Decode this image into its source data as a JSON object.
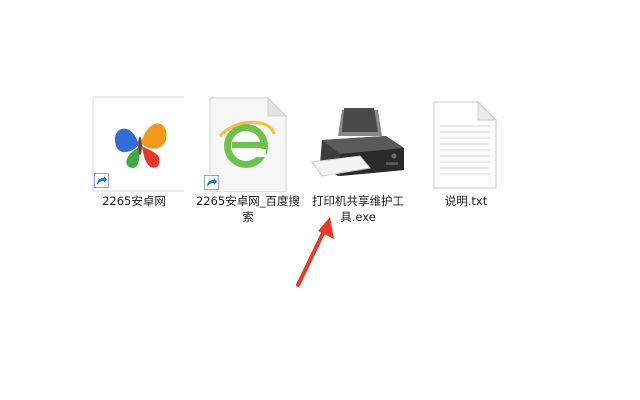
{
  "desktop": {
    "files": [
      {
        "name": "2265安卓网",
        "icon": "butterfly-shortcut-icon"
      },
      {
        "name": "2265安卓网_百度搜索",
        "icon": "browser-e-shortcut-icon"
      },
      {
        "name": "打印机共享维护工具.exe",
        "icon": "printer-icon"
      },
      {
        "name": "说明.txt",
        "icon": "text-document-icon"
      }
    ]
  },
  "annotation": {
    "arrow_color": "#e23a2b",
    "arrow_icon": "red-arrow-icon"
  },
  "colors": {
    "background": "#ffffff",
    "label_text": "#1a1a1a",
    "shortcut_arrow": "#2a6fc9"
  }
}
